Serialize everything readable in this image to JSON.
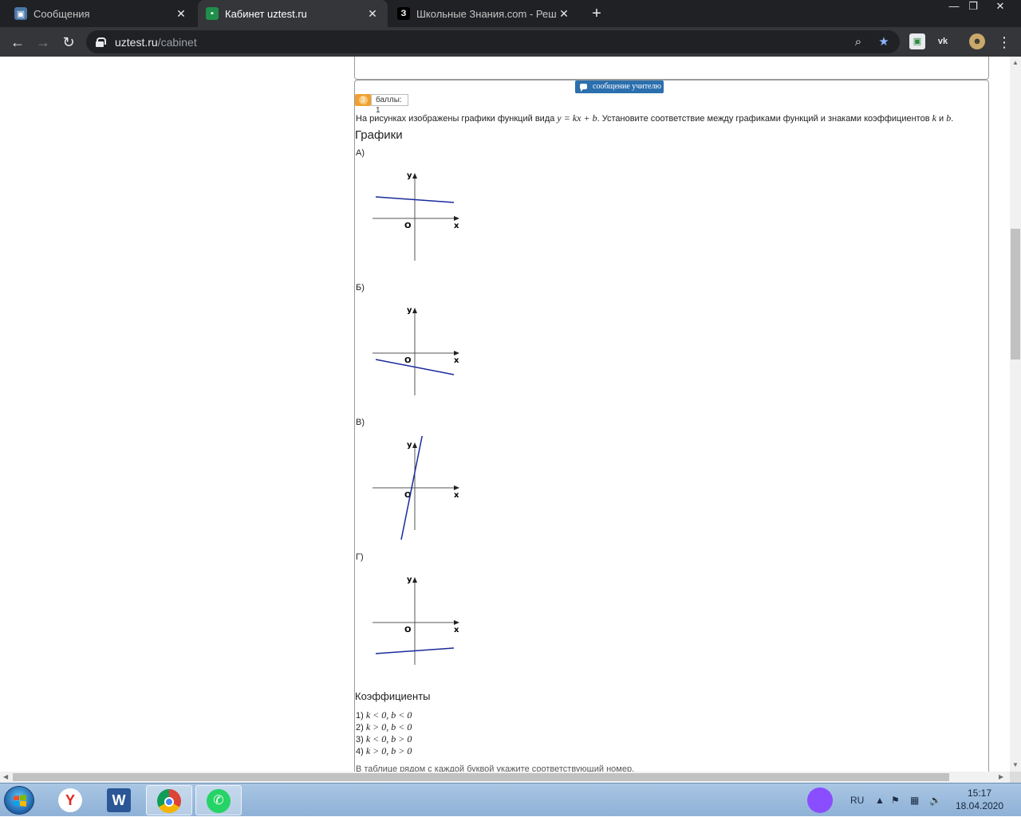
{
  "browser": {
    "tabs": [
      {
        "title": "Сообщения",
        "icon": "vk-messages-icon",
        "active": false
      },
      {
        "title": "Кабинет uztest.ru",
        "icon": "uztest-icon",
        "active": true
      },
      {
        "title": "Школьные Знания.com - Решае",
        "icon": "znania-icon",
        "active": false
      }
    ],
    "new_tab": "+",
    "url_host": "uztest.ru",
    "url_path": "/cabinet",
    "zoom_icon": "zoom-icon",
    "bookmark_icon": "star-icon"
  },
  "page": {
    "message_button": "сообщение учителю",
    "question_number": "3",
    "score_label": "баллы: 1",
    "prompt_before": "На рисунках изображены графики функций вида ",
    "prompt_formula": "y = kx + b",
    "prompt_after": ". Установите соответствие между графиками функций и знаками коэффициентов ",
    "prompt_k": "k",
    "prompt_and": " и ",
    "prompt_b": "b",
    "prompt_end": ".",
    "graphs_heading": "Графики",
    "graphs": [
      {
        "label": "А)",
        "axis_x": "x",
        "axis_y": "y",
        "origin": "O",
        "slope": "negative-small",
        "intercept": "positive"
      },
      {
        "label": "Б)",
        "axis_x": "x",
        "axis_y": "y",
        "origin": "O",
        "slope": "negative-small",
        "intercept": "negative"
      },
      {
        "label": "В)",
        "axis_x": "x",
        "axis_y": "y",
        "origin": "O",
        "slope": "positive-steep",
        "intercept": "positive"
      },
      {
        "label": "Г)",
        "axis_x": "x",
        "axis_y": "y",
        "origin": "O",
        "slope": "positive-small",
        "intercept": "negative"
      }
    ],
    "coefficients_heading": "Коэффициенты",
    "coefficients": [
      {
        "num": "1)",
        "text": "k < 0, b < 0"
      },
      {
        "num": "2)",
        "text": "k > 0, b < 0"
      },
      {
        "num": "3)",
        "text": "k < 0, b > 0"
      },
      {
        "num": "4)",
        "text": "k > 0, b > 0"
      }
    ],
    "hint": "В таблице рядом с каждой буквой укажите соответствующий номер."
  },
  "taskbar": {
    "language": "RU",
    "time": "15:17",
    "date": "18.04.2020"
  },
  "colors": {
    "graph_line": "#1a2a9c",
    "message_button": "#2b6fae",
    "question_badge": "#f0a030"
  }
}
